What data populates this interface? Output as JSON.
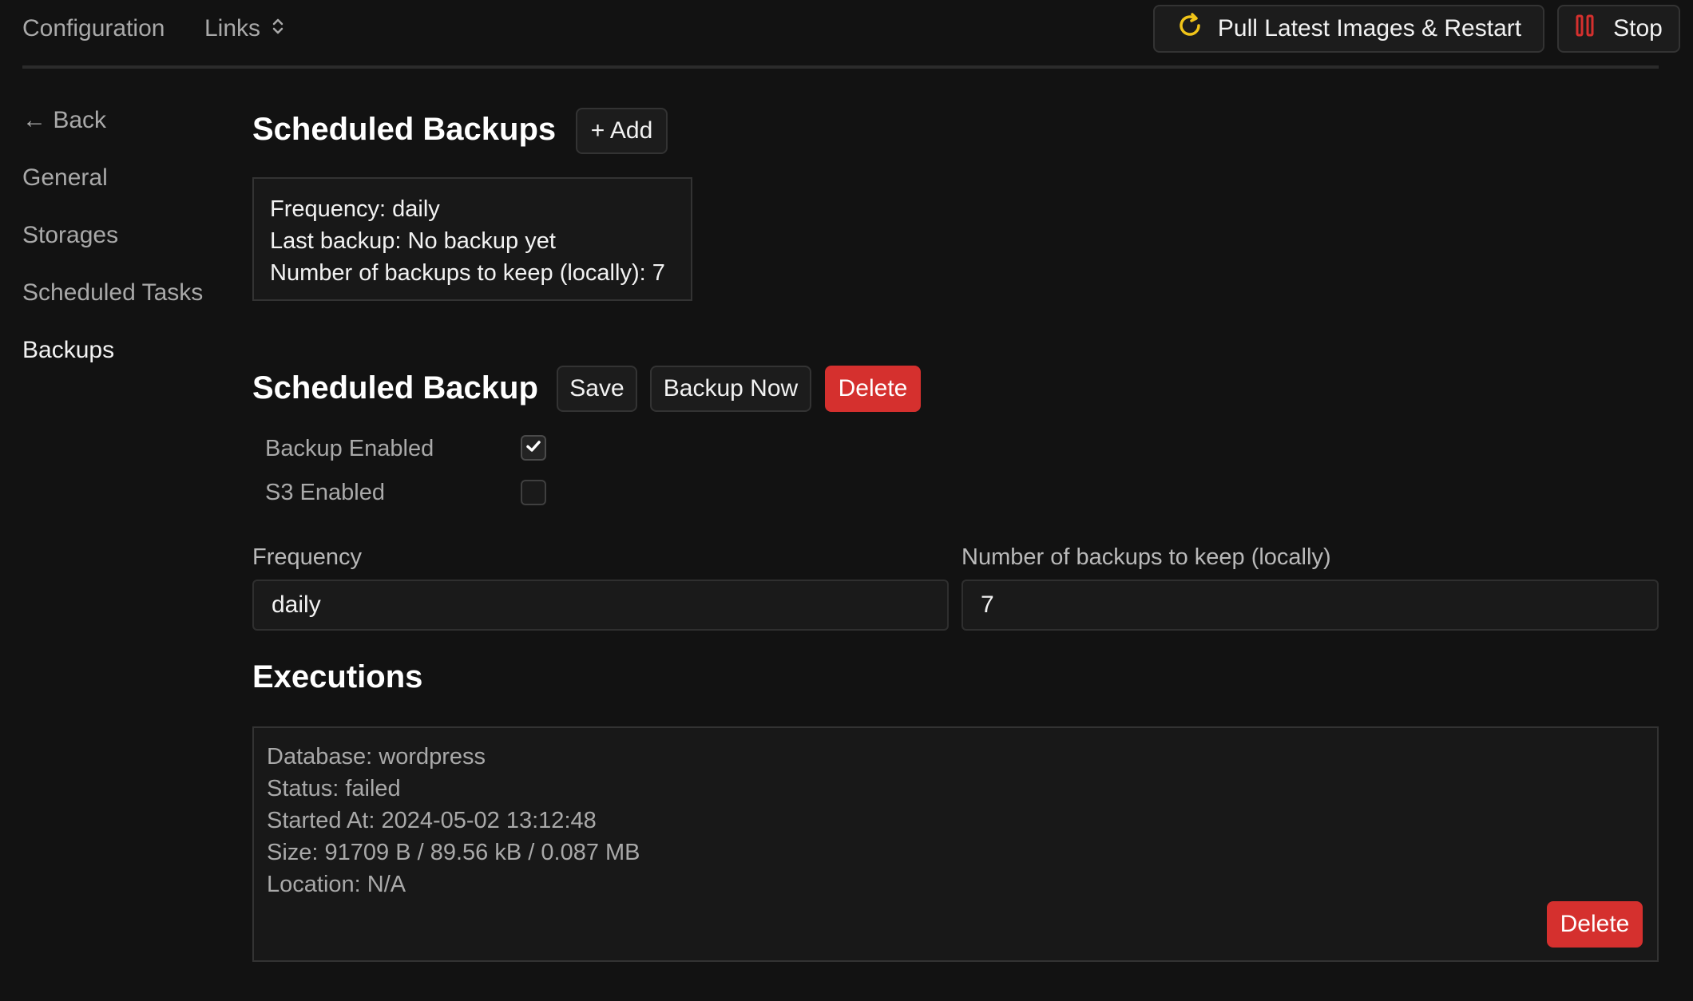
{
  "topbar": {
    "configuration": "Configuration",
    "links": "Links",
    "pull_button": "Pull Latest Images & Restart",
    "stop_button": "Stop"
  },
  "sidebar": {
    "items": [
      {
        "label": "← Back"
      },
      {
        "label": "General"
      },
      {
        "label": "Storages"
      },
      {
        "label": "Scheduled Tasks"
      },
      {
        "label": "Backups",
        "active": true
      }
    ]
  },
  "scheduled_backups": {
    "title": "Scheduled Backups",
    "add_label": "+ Add",
    "summary": {
      "frequency": "Frequency: daily",
      "last_backup": "Last backup: No backup yet",
      "keep": "Number of backups to keep (locally): 7"
    }
  },
  "scheduled_backup": {
    "title": "Scheduled Backup",
    "save_label": "Save",
    "backup_now_label": "Backup Now",
    "delete_label": "Delete",
    "backup_enabled_label": "Backup Enabled",
    "backup_enabled": true,
    "s3_enabled_label": "S3 Enabled",
    "s3_enabled": false,
    "frequency_label": "Frequency",
    "frequency_value": "daily",
    "keep_label": "Number of backups to keep (locally)",
    "keep_value": "7"
  },
  "executions": {
    "title": "Executions",
    "items": [
      {
        "database": "Database: wordpress",
        "status": "Status: failed",
        "started_at": "Started At: 2024-05-02 13:12:48",
        "size": "Size: 91709 B / 89.56 kB / 0.087 MB",
        "location": "Location: N/A",
        "delete_label": "Delete"
      }
    ]
  },
  "colors": {
    "background": "#121212",
    "danger": "#d5302e",
    "refresh_icon": "#f0c419",
    "stop_icon": "#d5302e"
  },
  "icons": [
    "refresh-icon",
    "stop-icon",
    "chevron-updown-icon",
    "checkmark-icon"
  ]
}
